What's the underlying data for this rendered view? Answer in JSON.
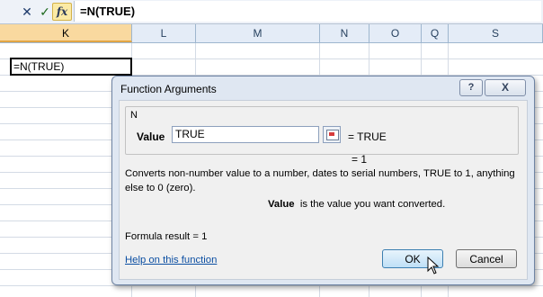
{
  "formula_bar": {
    "cancel_icon": "✕",
    "enter_icon": "✓",
    "fx_label": "fx",
    "content": "=N(TRUE)"
  },
  "columns": [
    "K",
    "L",
    "M",
    "N",
    "O",
    "Q",
    "S"
  ],
  "active_cell": {
    "value": "=N(TRUE)"
  },
  "dialog": {
    "title": "Function Arguments",
    "help_icon": "?",
    "close_icon": "X",
    "function_name": "N",
    "argument": {
      "label": "Value",
      "input_value": "TRUE",
      "evaluated": "=  TRUE"
    },
    "result_line": "=  1",
    "description": "Converts non-number value to a number, dates to serial numbers, TRUE to 1, anything else to 0 (zero).",
    "argument_desc_name": "Value",
    "argument_desc_text": "is the value you want converted.",
    "formula_result": "Formula result =   1",
    "help_link": "Help on this function",
    "ok_label": "OK",
    "cancel_label": "Cancel"
  },
  "colors": {
    "active_col_header": "#f9d99f",
    "dialog_bg": "#dfe7f2",
    "link": "#0b4ea2"
  }
}
